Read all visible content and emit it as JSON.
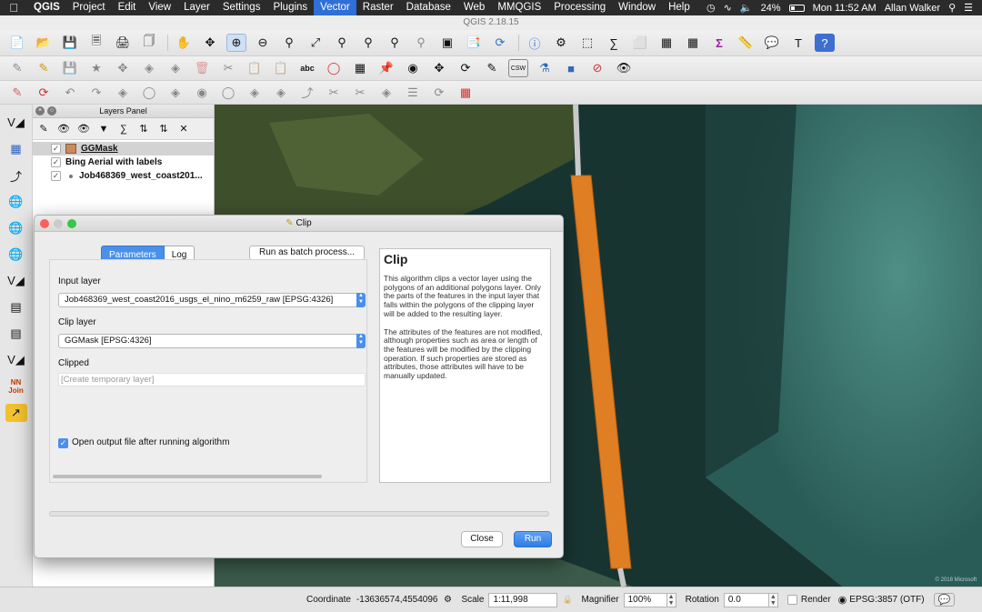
{
  "menubar": {
    "app": "QGIS",
    "items": [
      "Project",
      "Edit",
      "View",
      "Layer",
      "Settings",
      "Plugins",
      "Vector",
      "Raster",
      "Database",
      "Web",
      "MMQGIS",
      "Processing",
      "Window",
      "Help"
    ],
    "active_item": "Vector",
    "battery": "24%",
    "clock": "Mon 11:52 AM",
    "user": "Allan Walker"
  },
  "window": {
    "title": "QGIS 2.18.15"
  },
  "layers_panel": {
    "title": "Layers Panel",
    "layers": [
      {
        "name": "GGMask",
        "checked": true,
        "selected": true,
        "swatch": "#c98a5c"
      },
      {
        "name": "Bing Aerial with labels",
        "checked": true
      },
      {
        "name": "Job468369_west_coast201...",
        "checked": true
      }
    ]
  },
  "map": {
    "feature_color": "#e07e24",
    "attribution": "© 2018 Microsoft"
  },
  "dialog": {
    "title": "Clip",
    "tabs": [
      "Parameters",
      "Log"
    ],
    "batch_button": "Run as batch process...",
    "input_layer_label": "Input layer",
    "input_layer_value": "Job468369_west_coast2016_usgs_el_nino_m6259_raw [EPSG:4326]",
    "clip_layer_label": "Clip layer",
    "clip_layer_value": "GGMask [EPSG:4326]",
    "clipped_label": "Clipped",
    "clipped_placeholder": "[Create temporary layer]",
    "open_output_label": "Open output file after running algorithm",
    "open_output_checked": true,
    "help_title": "Clip",
    "help_p1": "This algorithm clips a vector layer using the polygons of an additional polygons layer. Only the parts of the features in the input layer that falls within the polygons of the clipping layer will be added to the resulting layer.",
    "help_p2": "The attributes of the features are not modified, although properties such as area or length of the features will be modified by the clipping operation. If such properties are stored as attributes, those attributes will have to be manually updated.",
    "close_button": "Close",
    "run_button": "Run"
  },
  "statusbar": {
    "coordinate_label": "Coordinate",
    "coordinate_value": "-13636574,4554096",
    "scale_label": "Scale",
    "scale_value": "1:11,998",
    "magnifier_label": "Magnifier",
    "magnifier_value": "100%",
    "rotation_label": "Rotation",
    "rotation_value": "0.0",
    "render_label": "Render",
    "crs": "EPSG:3857 (OTF)"
  }
}
